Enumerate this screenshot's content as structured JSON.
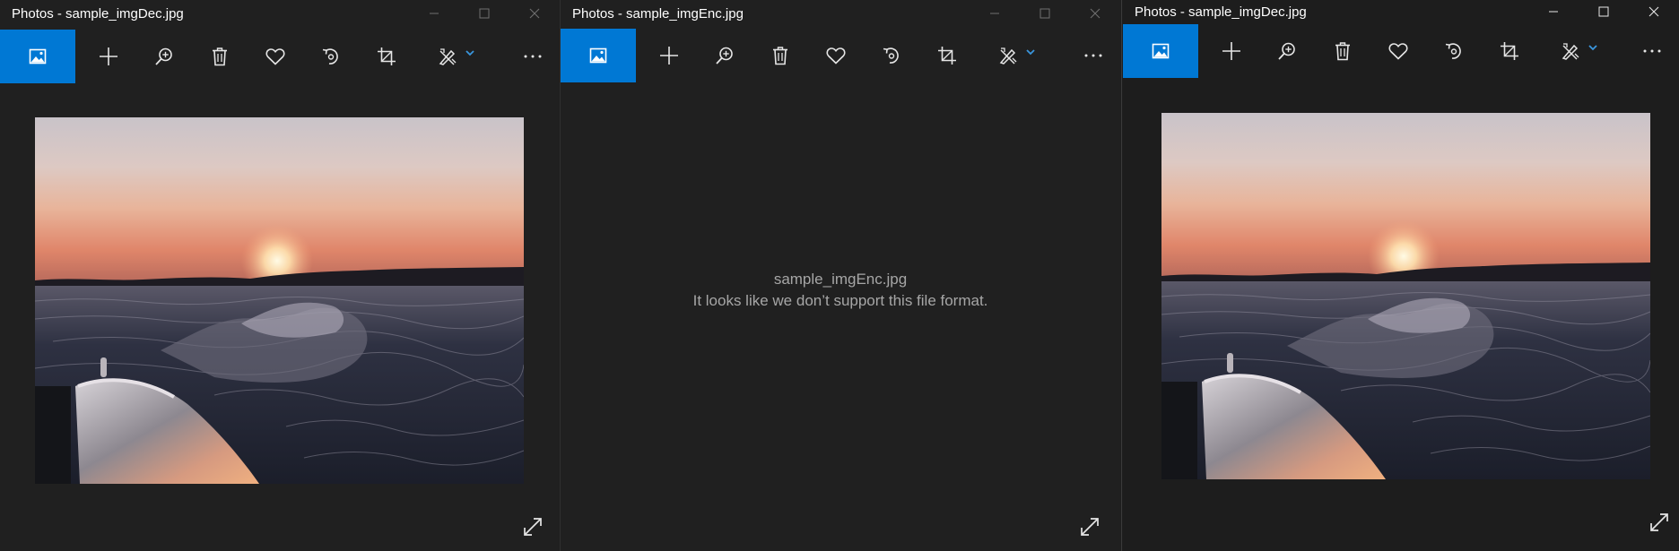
{
  "windows": [
    {
      "title": "Photos - sample_imgDec.jpg",
      "has_image": true
    },
    {
      "title": "Photos - sample_imgEnc.jpg",
      "has_image": false,
      "message": {
        "filename": "sample_imgEnc.jpg",
        "error": "It looks like we don’t support this file format."
      }
    },
    {
      "title": "Photos - sample_imgDec.jpg",
      "has_image": true
    }
  ],
  "toolbar_icons": [
    "image-home-icon",
    "add-icon",
    "zoom-in-icon",
    "delete-icon",
    "favorite-icon",
    "rotate-icon",
    "crop-icon",
    "edit-draw-icon",
    "chevron-down-icon",
    "more-icon"
  ],
  "window_controls": [
    "minimize-icon",
    "maximize-icon",
    "close-icon"
  ],
  "colors": {
    "accent": "#0078d4",
    "window_bg": "#202020",
    "message_text": "#a6a6a6"
  }
}
